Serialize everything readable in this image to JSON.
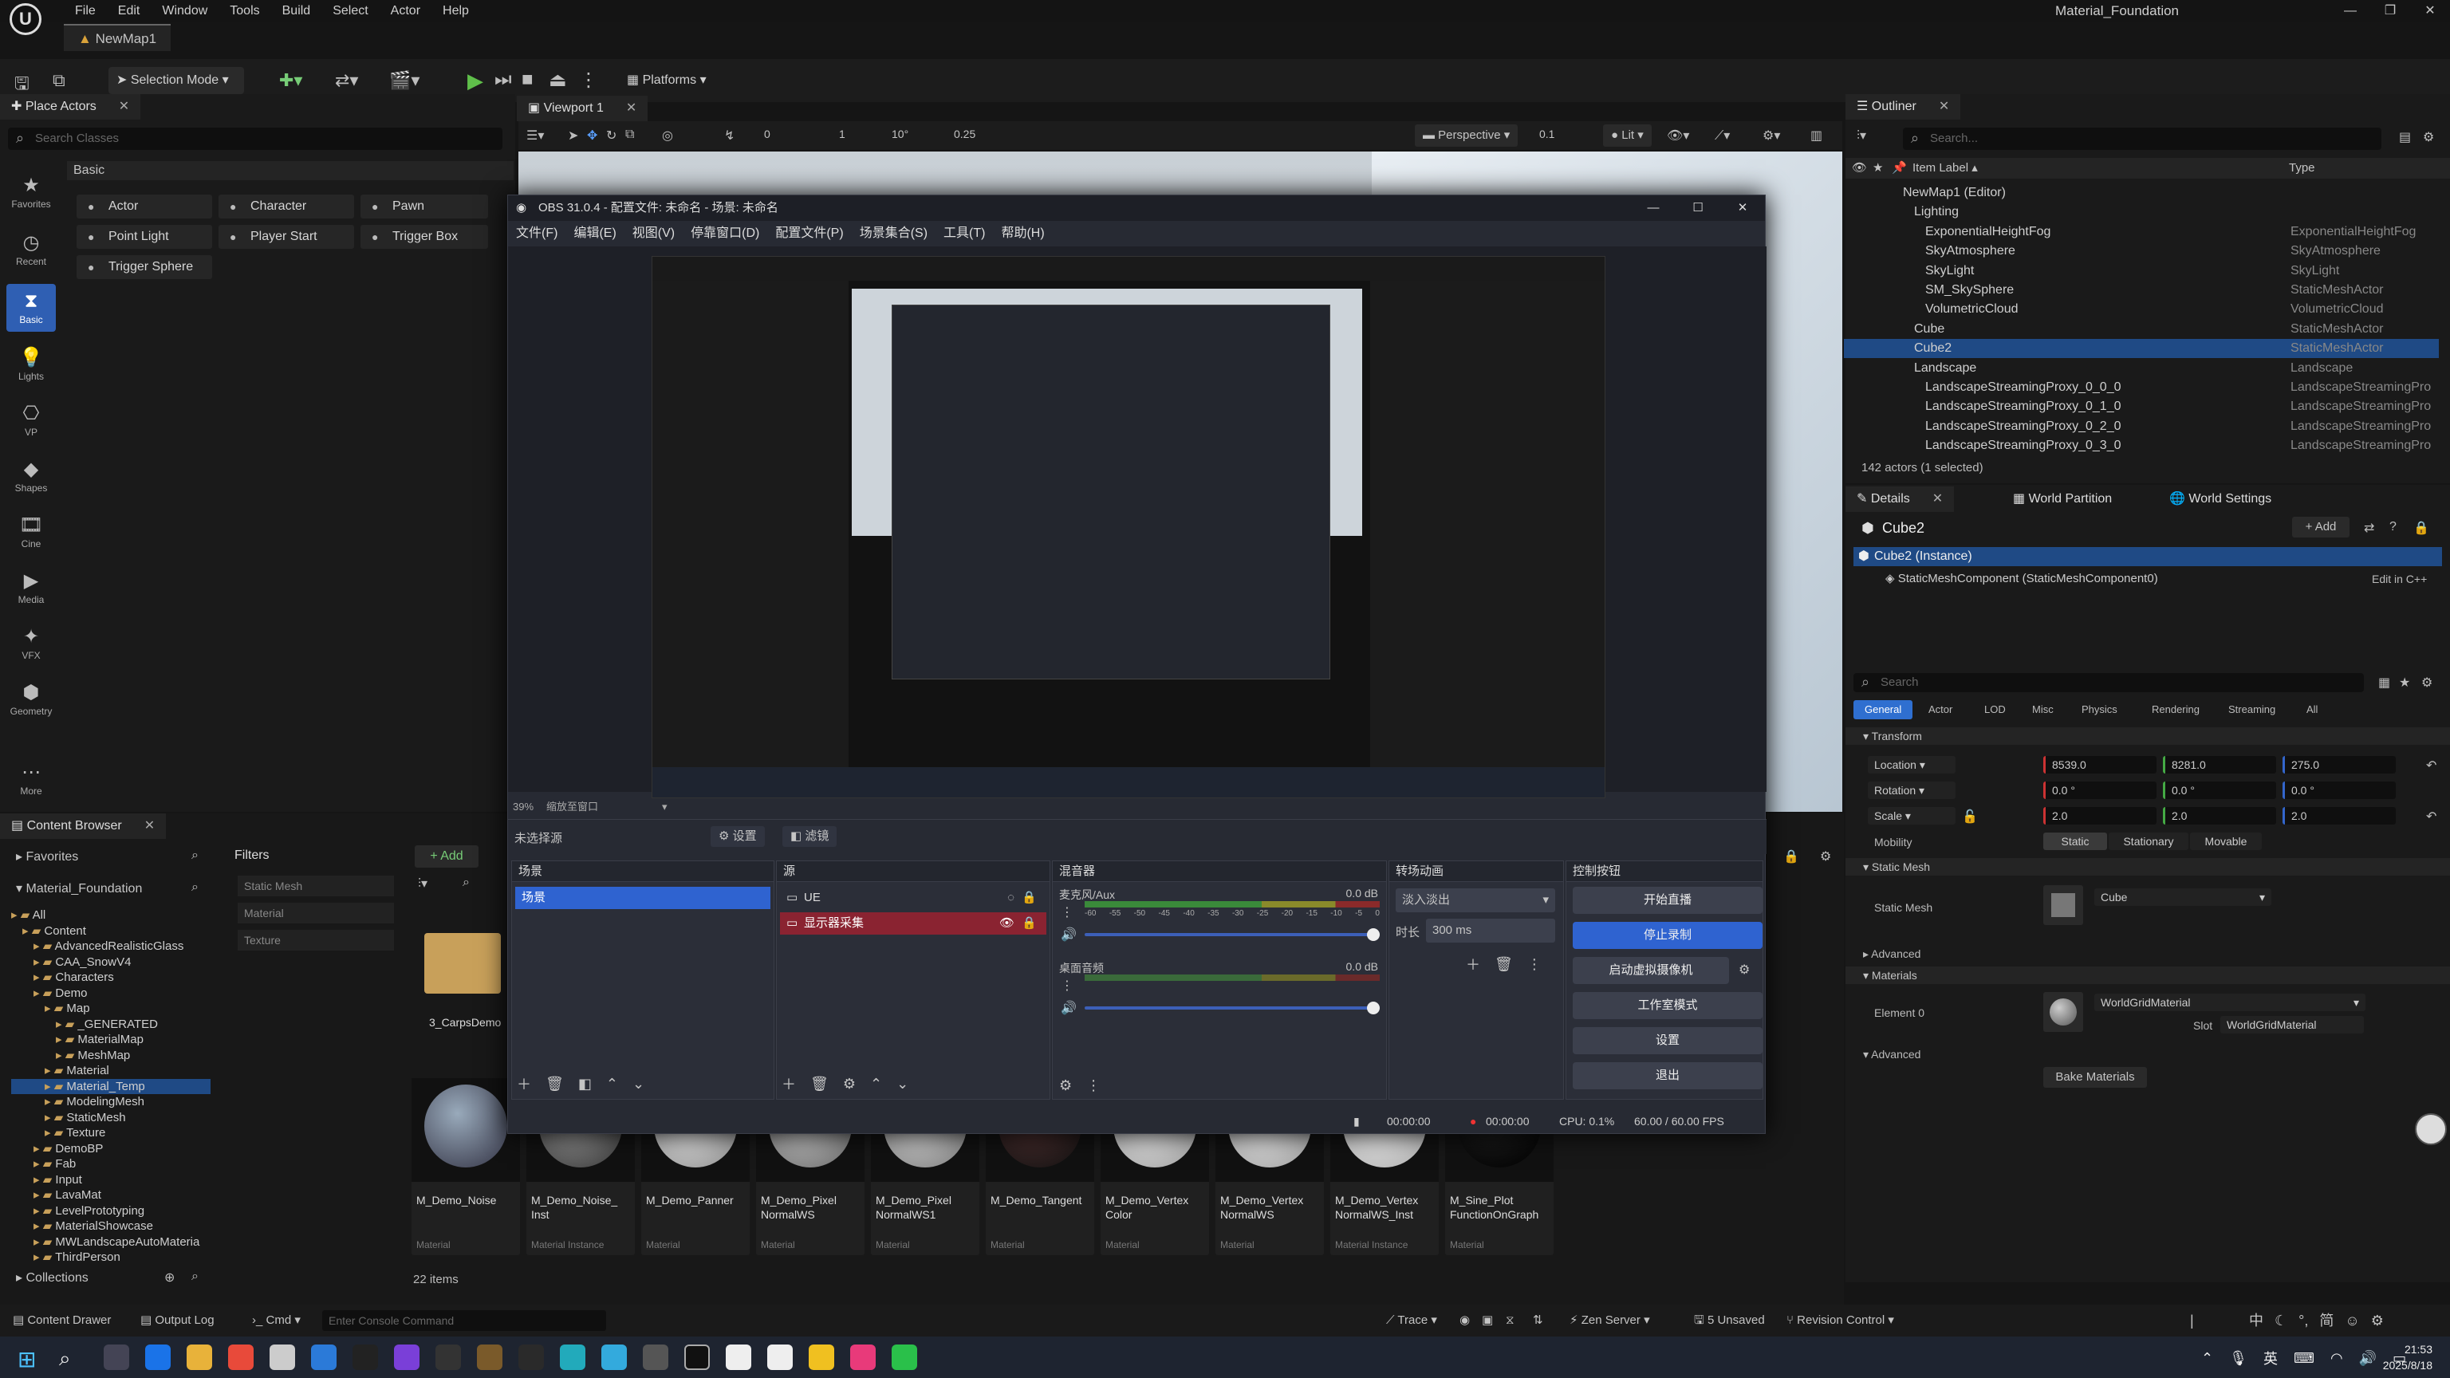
{
  "ue": {
    "menus": [
      "File",
      "Edit",
      "Window",
      "Tools",
      "Build",
      "Select",
      "Actor",
      "Help"
    ],
    "project": "Material_Foundation",
    "doc_tab": "NewMap1",
    "selection_mode": "Selection Mode",
    "platforms": "Platforms"
  },
  "place_actors": {
    "tab": "Place Actors",
    "search_placeholder": "Search Classes",
    "section": "Basic",
    "categories": [
      "Favorites",
      "Recent",
      "Basic",
      "Lights",
      "VP",
      "Shapes",
      "Cine",
      "Media",
      "VFX",
      "Geometry",
      "More"
    ],
    "items": [
      "Actor",
      "Character",
      "Pawn",
      "Point Light",
      "Player Start",
      "Trigger Box",
      "Trigger Sphere"
    ]
  },
  "viewport": {
    "tab": "Viewport 1",
    "perspective": "Perspective",
    "lit": "Lit",
    "snap_rot": "10°",
    "snap_scale": "0.25",
    "snap_grid": "0.1",
    "speed_a": "0",
    "speed_b": "1"
  },
  "obs": {
    "title": "OBS 31.0.4 - 配置文件: 未命名 - 场景: 未命名",
    "menus": [
      "文件(F)",
      "编辑(E)",
      "视图(V)",
      "停靠窗口(D)",
      "配置文件(P)",
      "场景集合(S)",
      "工具(T)",
      "帮助(H)"
    ],
    "zoom": "39%",
    "zoom_mode": "缩放至窗口",
    "no_source": "未选择源",
    "settings_btn": "设置",
    "filters_btn": "滤镜",
    "docks": {
      "scenes": "场景",
      "sources": "源",
      "mixer": "混音器",
      "transitions": "转场动画",
      "controls": "控制按钮"
    },
    "scene_item": "场景",
    "sources": [
      "UE",
      "显示器采集"
    ],
    "mixer": {
      "ch1": "麦克风/Aux",
      "ch1_db": "0.0 dB",
      "ch2": "桌面音频",
      "ch2_db": "0.0 dB",
      "scale": [
        "-60",
        "-55",
        "-50",
        "-45",
        "-40",
        "-35",
        "-30",
        "-25",
        "-20",
        "-15",
        "-10",
        "-5",
        "0"
      ]
    },
    "transition": {
      "type": "淡入淡出",
      "duration_label": "时长",
      "duration": "300 ms"
    },
    "controls": [
      "开始直播",
      "停止录制",
      "启动虚拟摄像机",
      "工作室模式",
      "设置",
      "退出"
    ],
    "status": {
      "t1": "00:00:00",
      "t2": "00:00:00",
      "cpu": "CPU: 0.1%",
      "fps": "60.00 / 60.00 FPS"
    }
  },
  "outliner": {
    "tab": "Outliner",
    "search_placeholder": "Search...",
    "col_label": "Item Label ▴",
    "col_type": "Type",
    "rows": [
      {
        "label": "NewMap1 (Editor)",
        "type": "",
        "indent": 1
      },
      {
        "label": "Lighting",
        "type": "",
        "indent": 2
      },
      {
        "label": "ExponentialHeightFog",
        "type": "ExponentialHeightFog",
        "indent": 3
      },
      {
        "label": "SkyAtmosphere",
        "type": "SkyAtmosphere",
        "indent": 3
      },
      {
        "label": "SkyLight",
        "type": "SkyLight",
        "indent": 3
      },
      {
        "label": "SM_SkySphere",
        "type": "StaticMeshActor",
        "indent": 3
      },
      {
        "label": "VolumetricCloud",
        "type": "VolumetricCloud",
        "indent": 3
      },
      {
        "label": "Cube",
        "type": "StaticMeshActor",
        "indent": 2
      },
      {
        "label": "Cube2",
        "type": "StaticMeshActor",
        "indent": 2
      },
      {
        "label": "Landscape",
        "type": "Landscape",
        "indent": 2
      },
      {
        "label": "LandscapeStreamingProxy_0_0_0",
        "type": "LandscapeStreamingPro",
        "indent": 3
      },
      {
        "label": "LandscapeStreamingProxy_0_1_0",
        "type": "LandscapeStreamingPro",
        "indent": 3
      },
      {
        "label": "LandscapeStreamingProxy_0_2_0",
        "type": "LandscapeStreamingPro",
        "indent": 3
      },
      {
        "label": "LandscapeStreamingProxy_0_3_0",
        "type": "LandscapeStreamingPro",
        "indent": 3
      }
    ],
    "footer": "142 actors (1 selected)"
  },
  "details": {
    "tabs": [
      "Details",
      "World Partition",
      "World Settings"
    ],
    "object": "Cube2",
    "add_btn": "+ Add",
    "instance": "Cube2 (Instance)",
    "component": "StaticMeshComponent (StaticMeshComponent0)",
    "edit_cpp": "Edit in C++",
    "search_placeholder": "Search",
    "filters": [
      "General",
      "Actor",
      "LOD",
      "Misc",
      "Physics",
      "Rendering",
      "Streaming",
      "All"
    ],
    "transform": "Transform",
    "location": "Location",
    "loc": [
      "8539.0",
      "8281.0",
      "275.0"
    ],
    "rotation": "Rotation",
    "rot": [
      "0.0 °",
      "0.0 °",
      "0.0 °"
    ],
    "scale": "Scale",
    "scl": [
      "2.0",
      "2.0",
      "2.0"
    ],
    "mobility": "Mobility",
    "mob": [
      "Static",
      "Stationary",
      "Movable"
    ],
    "static_mesh_sec": "Static Mesh",
    "static_mesh_lbl": "Static Mesh",
    "static_mesh_val": "Cube",
    "advanced": "Advanced",
    "materials": "Materials",
    "element0": "Element 0",
    "material_val": "WorldGridMaterial",
    "slot_lbl": "Slot",
    "slot_val": "WorldGridMaterial",
    "advanced2": "Advanced",
    "bake": "Bake Materials"
  },
  "content_browser": {
    "tab": "Content Browser",
    "favorites": "Favorites",
    "project": "Material_Foundation",
    "filters": "Filters",
    "filter_items": [
      "Static Mesh",
      "Material",
      "Texture"
    ],
    "add": "+ Add",
    "tree": [
      {
        "l": "All",
        "d": 0
      },
      {
        "l": "Content",
        "d": 1
      },
      {
        "l": "AdvancedRealisticGlass",
        "d": 2
      },
      {
        "l": "CAA_SnowV4",
        "d": 2
      },
      {
        "l": "Characters",
        "d": 2
      },
      {
        "l": "Demo",
        "d": 2
      },
      {
        "l": "Map",
        "d": 3
      },
      {
        "l": "_GENERATED",
        "d": 4
      },
      {
        "l": "MaterialMap",
        "d": 4
      },
      {
        "l": "MeshMap",
        "d": 4
      },
      {
        "l": "Material",
        "d": 3
      },
      {
        "l": "Material_Temp",
        "d": 3
      },
      {
        "l": "ModelingMesh",
        "d": 3
      },
      {
        "l": "StaticMesh",
        "d": 3
      },
      {
        "l": "Texture",
        "d": 3
      },
      {
        "l": "DemoBP",
        "d": 2
      },
      {
        "l": "Fab",
        "d": 2
      },
      {
        "l": "Input",
        "d": 2
      },
      {
        "l": "LavaMat",
        "d": 2
      },
      {
        "l": "LevelPrototyping",
        "d": 2
      },
      {
        "l": "MaterialShowcase",
        "d": 2
      },
      {
        "l": "MWLandscapeAutoMateria",
        "d": 2
      },
      {
        "l": "ThirdPerson",
        "d": 2
      }
    ],
    "folder": "3_CarpsDemo",
    "tiles": [
      {
        "n": "M_Demo_Noise",
        "t": "Material"
      },
      {
        "n": "M_Demo_Noise_ Inst",
        "t": "Material Instance"
      },
      {
        "n": "M_Demo_Panner",
        "t": "Material"
      },
      {
        "n": "M_Demo_Pixel NormalWS",
        "t": "Material"
      },
      {
        "n": "M_Demo_Pixel NormalWS1",
        "t": "Material"
      },
      {
        "n": "M_Demo_Tangent",
        "t": "Material"
      },
      {
        "n": "M_Demo_Vertex Color",
        "t": "Material"
      },
      {
        "n": "M_Demo_Vertex NormalWS",
        "t": "Material"
      },
      {
        "n": "M_Demo_Vertex NormalWS_Inst",
        "t": "Material Instance"
      },
      {
        "n": "M_Sine_Plot FunctionOnGraph",
        "t": "Material"
      }
    ],
    "count": "22 items",
    "collections": "Collections"
  },
  "statusbar": {
    "drawer": "Content Drawer",
    "log": "Output Log",
    "cmd": "Cmd",
    "console_placeholder": "Enter Console Command",
    "trace": "Trace",
    "zen": "Zen Server",
    "unsaved": "5 Unsaved",
    "rc": "Revision Control"
  },
  "tray": {
    "time": "21:53",
    "date": "2025/8/18",
    "ime": "中"
  }
}
